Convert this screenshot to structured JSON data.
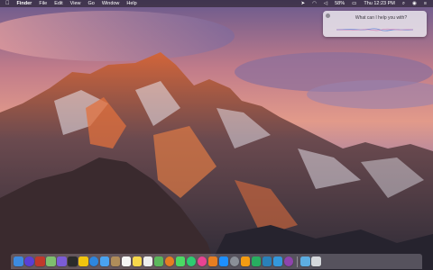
{
  "menubar": {
    "apple_icon": "apple-logo-icon",
    "app_name": "Finder",
    "menus": [
      "File",
      "Edit",
      "View",
      "Go",
      "Window",
      "Help"
    ],
    "battery": "58%",
    "clock": "Thu 12:23 PM",
    "status_icons": [
      "location-icon",
      "wifi-icon",
      "volume-icon",
      "battery-icon",
      "search-icon",
      "siri-icon",
      "notification-icon"
    ]
  },
  "siri": {
    "prompt": "What can I help you with?",
    "close_icon": "close-icon"
  },
  "dock": {
    "icons": [
      {
        "name": "finder-icon",
        "color": "#3d8be0"
      },
      {
        "name": "siri-icon",
        "color": "#5a3fd6"
      },
      {
        "name": "photo-booth-icon",
        "color": "#c0392b"
      },
      {
        "name": "maps-icon",
        "color": "#7fbf6e"
      },
      {
        "name": "imovie-icon",
        "color": "#7b5cd6"
      },
      {
        "name": "clapper-icon",
        "color": "#2b2b2b"
      },
      {
        "name": "photos-icon",
        "color": "#f1c40f"
      },
      {
        "name": "safari-icon",
        "color": "#2e86de"
      },
      {
        "name": "mail-icon",
        "color": "#4aa3f0"
      },
      {
        "name": "contacts-icon",
        "color": "#b08d5a"
      },
      {
        "name": "calendar-icon",
        "color": "#f5f5f5"
      },
      {
        "name": "notes-icon",
        "color": "#f7d84b"
      },
      {
        "name": "reminders-icon",
        "color": "#eeeeee"
      },
      {
        "name": "maps-app-icon",
        "color": "#5cb85c"
      },
      {
        "name": "photos-app-icon",
        "color": "#e67e22"
      },
      {
        "name": "messages-icon",
        "color": "#4cd964"
      },
      {
        "name": "facetime-icon",
        "color": "#2ecc71"
      },
      {
        "name": "itunes-icon",
        "color": "#e84393"
      },
      {
        "name": "ibooks-icon",
        "color": "#e67e22"
      },
      {
        "name": "app-store-icon",
        "color": "#1e90ff"
      },
      {
        "name": "system-preferences-icon",
        "color": "#8a8f98"
      },
      {
        "name": "pages-icon",
        "color": "#f39c12"
      },
      {
        "name": "numbers-icon",
        "color": "#27ae60"
      },
      {
        "name": "keynote-icon",
        "color": "#2980b9"
      },
      {
        "name": "xcode-icon",
        "color": "#3498db"
      },
      {
        "name": "migration-icon",
        "color": "#8e44ad"
      },
      {
        "name": "downloads-folder-icon",
        "color": "#5dade2"
      },
      {
        "name": "trash-icon",
        "color": "#d5d8dc"
      }
    ]
  }
}
